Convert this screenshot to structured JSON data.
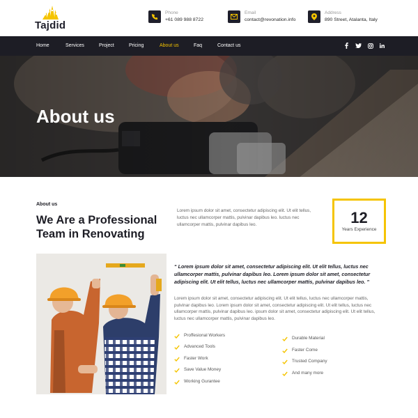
{
  "brand": {
    "name": "Tajdid",
    "accent": "#f5c400",
    "dark": "#1d1d25"
  },
  "contact": {
    "phone": {
      "icon": "phone-icon",
      "label": "Phone",
      "value": "+61 089 988 8722"
    },
    "email": {
      "icon": "email-icon",
      "label": "Email",
      "value": "contact@revonation.info"
    },
    "address": {
      "icon": "location-icon",
      "label": "Address",
      "value": "890 Street, Atalanta, Italy"
    }
  },
  "nav": {
    "items": [
      "Home",
      "Services",
      "Project",
      "Pricing",
      "About us",
      "Faq",
      "Contact us"
    ],
    "active": "About us",
    "social": [
      "facebook-icon",
      "twitter-icon",
      "instagram-icon",
      "linkedin-icon"
    ]
  },
  "hero": {
    "title": "About us"
  },
  "about": {
    "eyebrow": "About us",
    "heading": "We Are a Professional Team in Renovating",
    "intro": "Lorem ipsum dolor sit amet, consectetur adipiscing elit. Ut elit tellus, luctus nec ullamcorper mattis, pulvinar dapibus leo. luctus nec ullamcorper mattis, pulvinar dapibus leo.",
    "experience": {
      "number": "12",
      "label": "Years Experience"
    },
    "quote": "“ Lorem ipsum dolor sit amet, consectetur adipiscing elit. Ut elit tellus, luctus nec ullamcorper mattis, pulvinar dapibus leo. Lorem ipsum dolor sit amet, consectetur adipiscing elit. Ut elit tellus, luctus nec ullamcorper mattis, pulvinar dapibus leo. ”",
    "body": "Lorem ipsum dolor sit amet, consectetur adipiscing elit. Ut elit tellus, luctus nec ullamcorper mattis, pulvinar dapibus leo. Lorem ipsum dolor sit amet, consectetur adipiscing elit. Ut elit tellus, luctus nec ullamcorper mattis, pulvinar dapibus leo. ipsum dolor sit amet, consectetur adipiscing elit. Ut elit tellus, luctus nec ullamcorper mattis, pulvinar dapibus leo.",
    "features_left": [
      "Proffesional Workers",
      "Advanced Tools",
      "Faster Work",
      "Save Value Money",
      "Working Gurantee"
    ],
    "features_right": [
      "Durable Material",
      "Faster Come",
      "Trusted Company",
      "And many more"
    ]
  }
}
